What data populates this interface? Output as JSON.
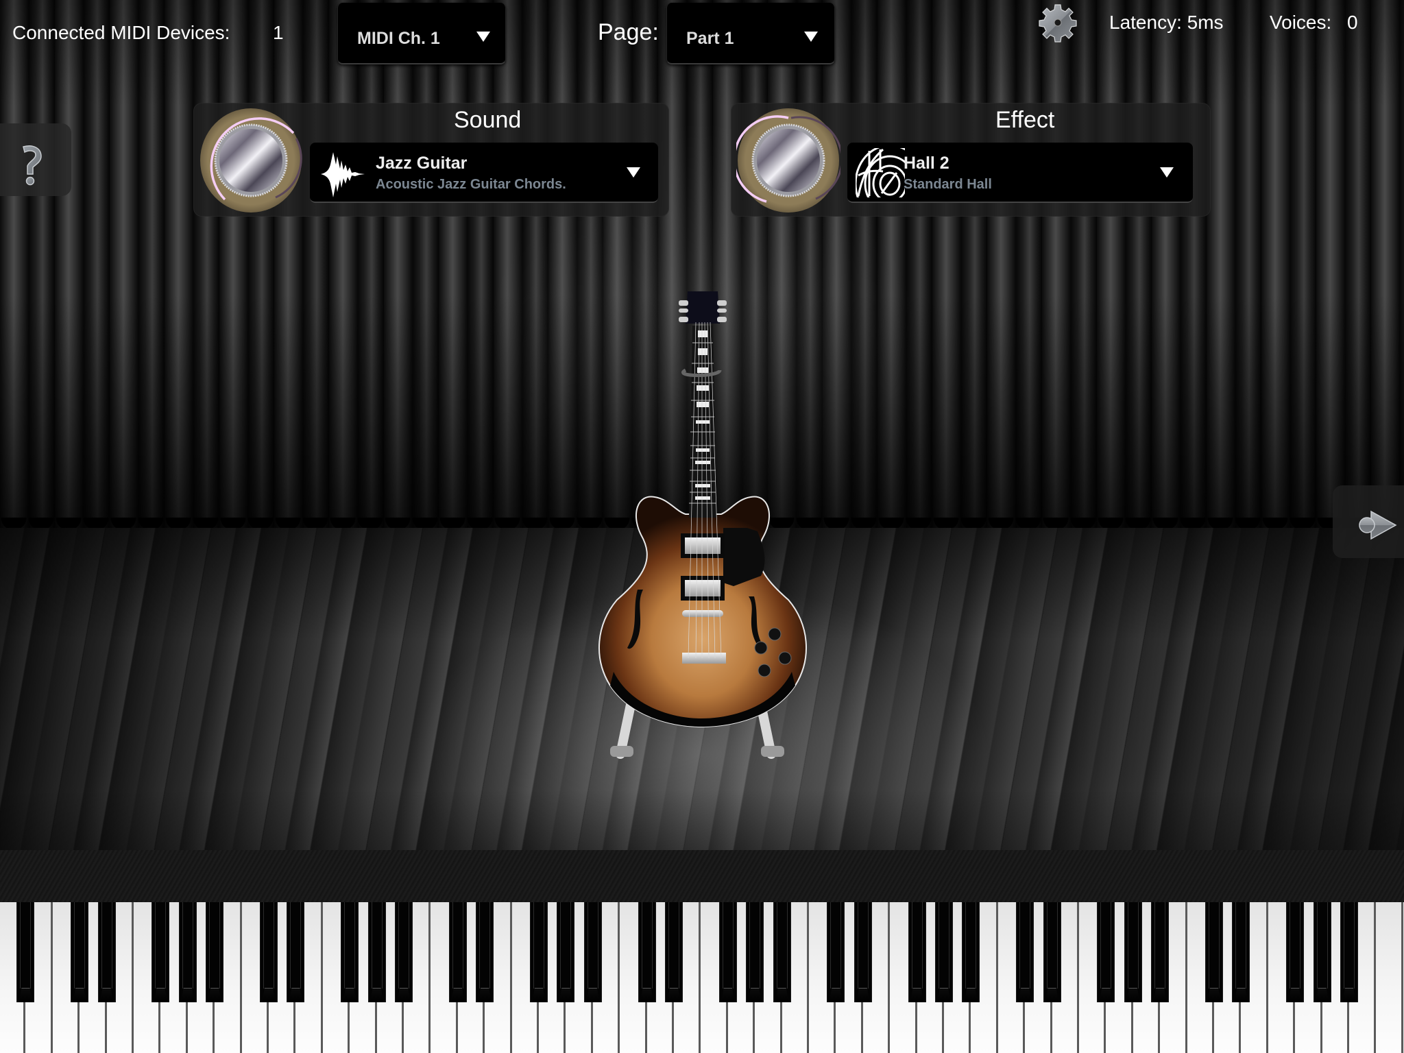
{
  "topbar": {
    "midi_devices_label": "Connected MIDI Devices:",
    "midi_devices_count": "1",
    "midi_channel": {
      "selected": "MIDI Ch. 1"
    },
    "page_label": "Page:",
    "page": {
      "selected": "Part 1"
    },
    "settings_icon": "gear-icon",
    "latency": "Latency: 5ms",
    "voices_label": "Voices:",
    "voices_count": "0"
  },
  "side": {
    "help_icon": "question-mark-icon",
    "next_icon": "arrow-right-icon"
  },
  "sound": {
    "title": "Sound",
    "knob_icon": "volume-knob",
    "icon": "waveform-icon",
    "name": "Jazz Guitar",
    "description": "Acoustic Jazz Guitar Chords."
  },
  "effect": {
    "title": "Effect",
    "knob_icon": "effect-knob",
    "icon": "reverb-hall-icon",
    "name": "Hall 2",
    "description": "Standard Hall"
  },
  "instrument": {
    "image": "semi-hollow-jazz-guitar-on-stand"
  },
  "keyboard": {
    "first_note": "A0",
    "last_note": "C8",
    "white_key_count": 52,
    "start_white_name": "A",
    "accent_colors": {
      "knob_ring": "#f0c8f0",
      "knob_body": "#8a7a56",
      "subtitle": "#7c8792"
    }
  }
}
